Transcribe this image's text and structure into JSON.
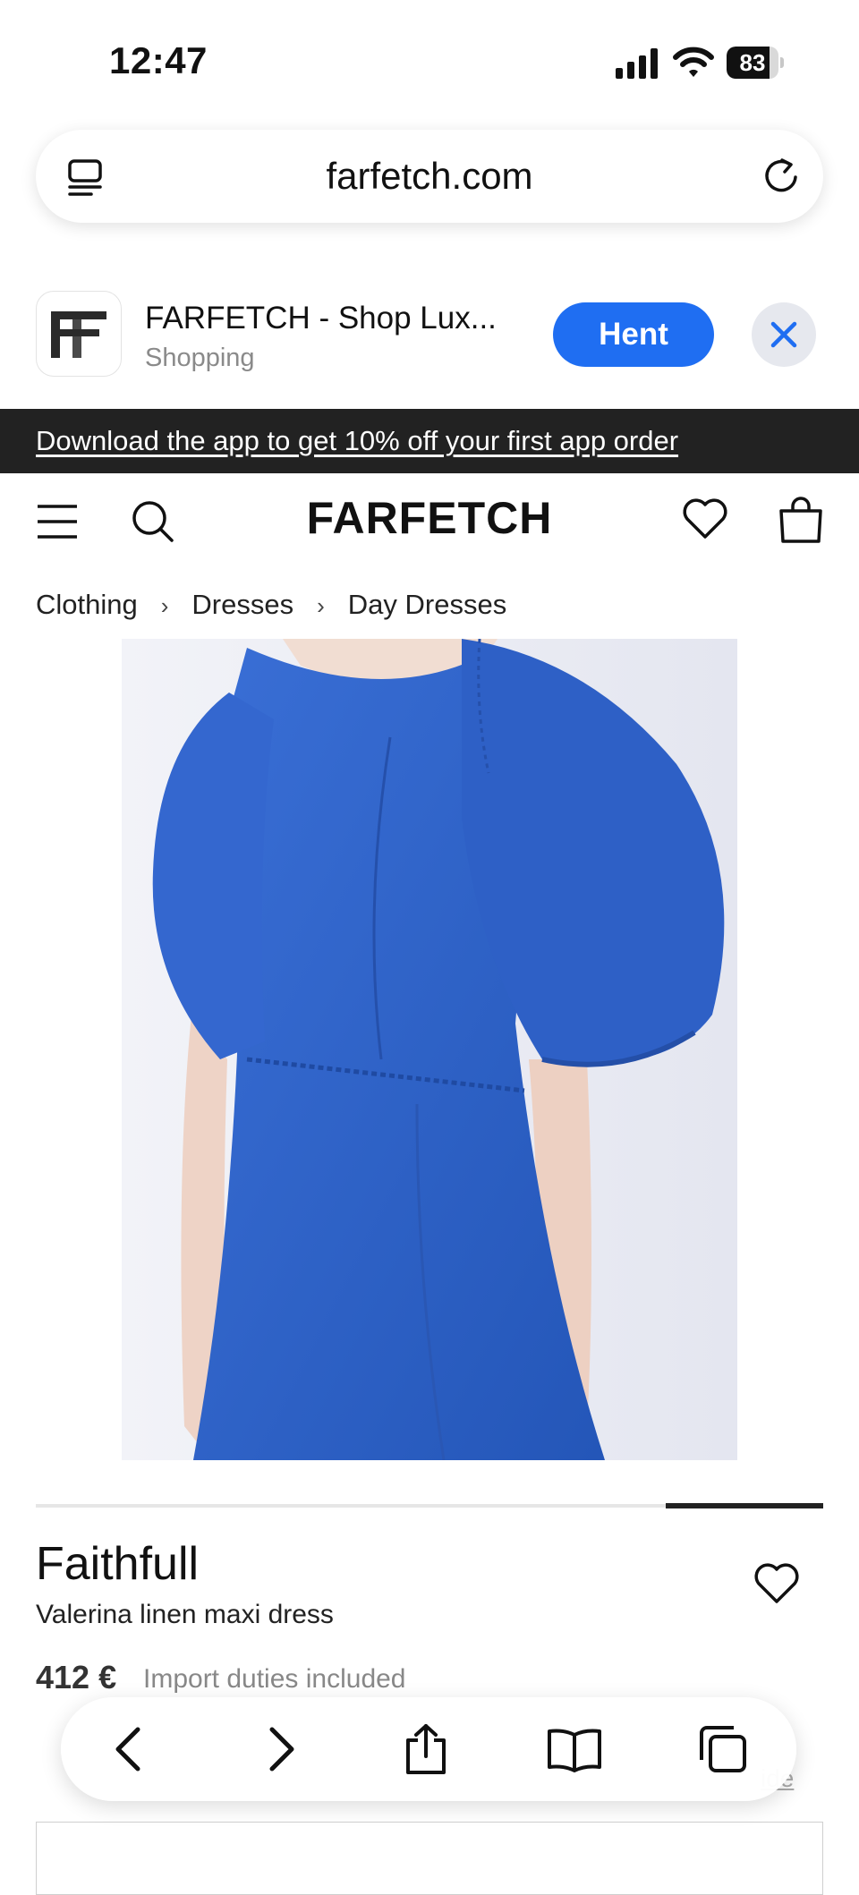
{
  "status_bar": {
    "time": "12:47",
    "battery": "83",
    "battery_level": 0.83
  },
  "browser": {
    "url": "farfetch.com"
  },
  "app_banner": {
    "title": "FARFETCH - Shop Lux...",
    "subtitle": "Shopping",
    "get_label": "Hent"
  },
  "promo": {
    "text": "Download the app to get 10% off your first app order"
  },
  "site": {
    "logo": "FARFETCH"
  },
  "breadcrumb": {
    "items": [
      "Clothing",
      "Dresses",
      "Day Dresses"
    ],
    "separator": "›"
  },
  "product": {
    "brand": "Faithfull",
    "name": "Valerina linen maxi dress",
    "price": "412 €",
    "duties_note": "Import duties included",
    "size_guide_label": "ide",
    "dress_color": "#2f62c7"
  },
  "icons": [
    "tabs-icon",
    "reload-icon",
    "close-icon",
    "menu-icon",
    "search-icon",
    "heart-icon",
    "bag-icon",
    "back-icon",
    "forward-icon",
    "share-icon",
    "bookmarks-icon",
    "tabs-overview-icon"
  ]
}
